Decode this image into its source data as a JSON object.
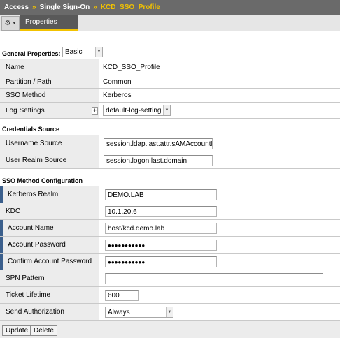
{
  "breadcrumb": {
    "items": [
      "Access",
      "Single Sign-On",
      "KCD_SSO_Profile"
    ],
    "separator": "»"
  },
  "tabs": {
    "gear_icon": "gear-icon",
    "active_tab": "Properties"
  },
  "general": {
    "title": "General Properties:",
    "view_mode": "Basic",
    "rows": [
      {
        "label": "Name",
        "value": "KCD_SSO_Profile"
      },
      {
        "label": "Partition / Path",
        "value": "Common"
      },
      {
        "label": "SSO Method",
        "value": "Kerberos"
      },
      {
        "label": "Log Settings",
        "value": "default-log-setting",
        "plus": "+"
      }
    ]
  },
  "credentials": {
    "title": "Credentials Source",
    "rows": [
      {
        "label": "Username Source",
        "value": "session.ldap.last.attr.sAMAccountNan"
      },
      {
        "label": "User Realm Source",
        "value": "session.logon.last.domain"
      }
    ]
  },
  "sso": {
    "title": "SSO Method Configuration",
    "rows": [
      {
        "label": "Kerberos Realm",
        "value": "DEMO.LAB"
      },
      {
        "label": "KDC",
        "value": "10.1.20.6"
      },
      {
        "label": "Account Name",
        "value": "host/kcd.demo.lab"
      },
      {
        "label": "Account Password",
        "value": "●●●●●●●●●●●"
      },
      {
        "label": "Confirm Account Password",
        "value": "●●●●●●●●●●●"
      },
      {
        "label": "SPN Pattern",
        "value": ""
      },
      {
        "label": "Ticket Lifetime",
        "value": "600"
      },
      {
        "label": "Send Authorization",
        "value": "Always"
      }
    ]
  },
  "footer": {
    "update_label": "Update",
    "delete_label": "Delete"
  },
  "colors": {
    "header_bg": "#6a6a6a",
    "accent": "#f2c200",
    "required_marker": "#3b5f8c",
    "label_bg": "#ececec"
  }
}
